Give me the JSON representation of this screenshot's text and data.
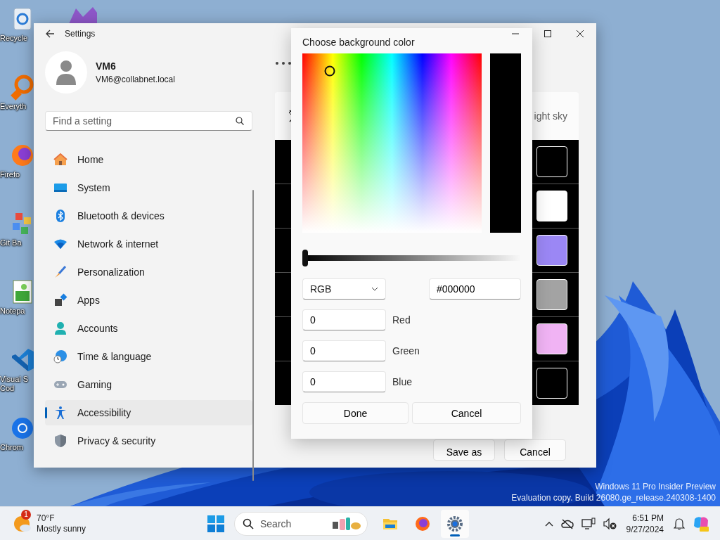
{
  "desktop": {
    "icons": [
      {
        "label": "Recycle"
      },
      {
        "label": "Everyth"
      },
      {
        "label": "Firefo"
      },
      {
        "label": "Git Ba"
      },
      {
        "label": "Notepa"
      },
      {
        "label": "Visual S Cod"
      },
      {
        "label": "Chrom"
      }
    ],
    "watermark": [
      "Windows 11 Pro Insider Preview",
      "Evaluation copy. Build 26080.ge_release.240308-1400"
    ]
  },
  "settings": {
    "title": "Settings",
    "user": {
      "name": "VM6",
      "email": "VM6@collabnet.local"
    },
    "search": {
      "placeholder": "Find a setting"
    },
    "nav": [
      {
        "label": "Home",
        "selected": false
      },
      {
        "label": "System",
        "selected": false
      },
      {
        "label": "Bluetooth & devices",
        "selected": false
      },
      {
        "label": "Network & internet",
        "selected": false
      },
      {
        "label": "Personalization",
        "selected": false
      },
      {
        "label": "Apps",
        "selected": false
      },
      {
        "label": "Accounts",
        "selected": false
      },
      {
        "label": "Time & language",
        "selected": false
      },
      {
        "label": "Gaming",
        "selected": false
      },
      {
        "label": "Accessibility",
        "selected": true
      },
      {
        "label": "Privacy & security",
        "selected": false
      }
    ],
    "theme_card": {
      "text": "ight sky"
    },
    "swatches": [
      {
        "color": "#000000"
      },
      {
        "color": "#ffffff"
      },
      {
        "color": "#9b87f5"
      },
      {
        "color": "#a3a3a3"
      },
      {
        "color": "#f0b3f4"
      },
      {
        "color": "#000000"
      }
    ],
    "buttons": [
      "Save as",
      "Cancel"
    ]
  },
  "dialog": {
    "title": "Choose background color",
    "slider": {
      "level": 0
    },
    "mode": "RGB",
    "hex": "#000000",
    "channels": [
      {
        "label": "Red",
        "value": "0"
      },
      {
        "label": "Green",
        "value": "0"
      },
      {
        "label": "Blue",
        "value": "0"
      }
    ],
    "buttons": [
      "Done",
      "Cancel"
    ]
  },
  "taskbar": {
    "weather": {
      "badge": "1",
      "temperature": "70°F",
      "condition": "Mostly sunny"
    },
    "search": {
      "placeholder": "Search"
    },
    "apps": [
      {
        "selected": false
      },
      {
        "selected": false
      },
      {
        "selected": true
      }
    ],
    "clock": {
      "time": "6:51 PM",
      "date": "9/27/2024"
    }
  }
}
